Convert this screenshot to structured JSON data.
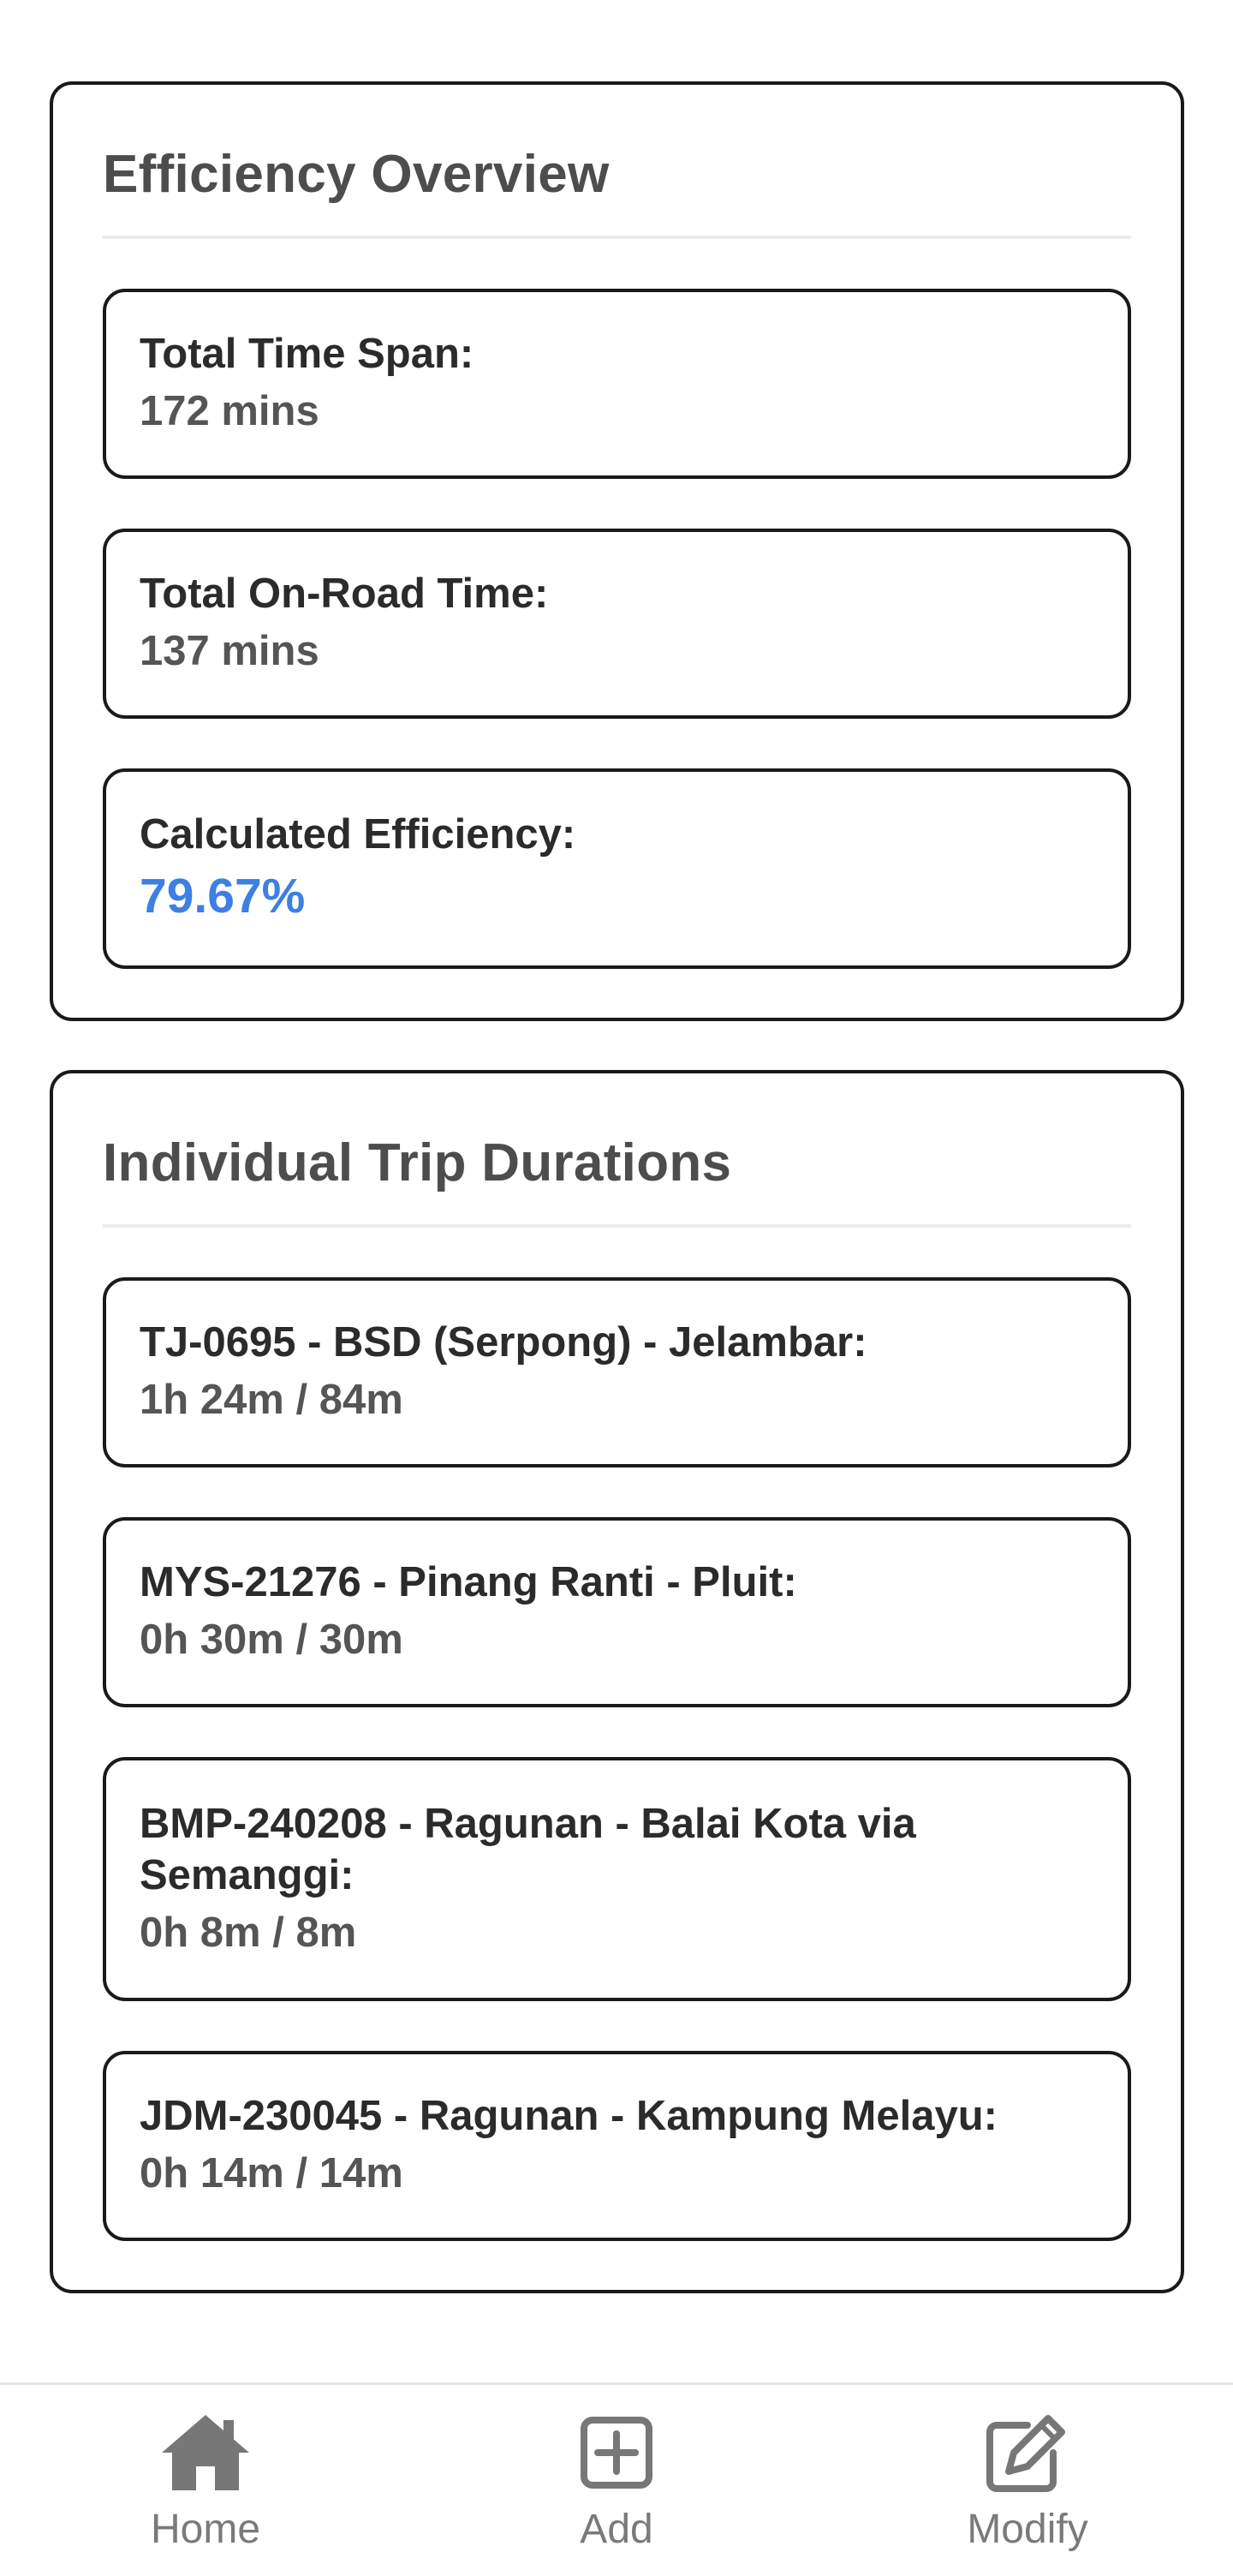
{
  "efficiency": {
    "title": "Efficiency Overview",
    "items": [
      {
        "label": "Total Time Span:",
        "value": "172 mins"
      },
      {
        "label": "Total On-Road Time:",
        "value": "137 mins"
      },
      {
        "label": "Calculated Efficiency:",
        "value": "79.67%"
      }
    ]
  },
  "trips": {
    "title": "Individual Trip Durations",
    "items": [
      {
        "label": "TJ-0695 - BSD (Serpong) - Jelambar:",
        "value": "1h 24m / 84m"
      },
      {
        "label": "MYS-21276 - Pinang Ranti - Pluit:",
        "value": "0h 30m / 30m"
      },
      {
        "label": "BMP-240208 - Ragunan - Balai Kota via Semanggi:",
        "value": "0h 8m / 8m"
      },
      {
        "label": "JDM-230045 - Ragunan - Kampung Melayu:",
        "value": "0h 14m / 14m"
      }
    ]
  },
  "nav": {
    "home": {
      "label": "Home",
      "icon": "home-icon"
    },
    "add": {
      "label": "Add",
      "icon": "plus-square-icon"
    },
    "modify": {
      "label": "Modify",
      "icon": "edit-icon"
    }
  },
  "colors": {
    "accent": "#3d7fe3",
    "border": "#1a1a1a",
    "nav": "#777777"
  }
}
